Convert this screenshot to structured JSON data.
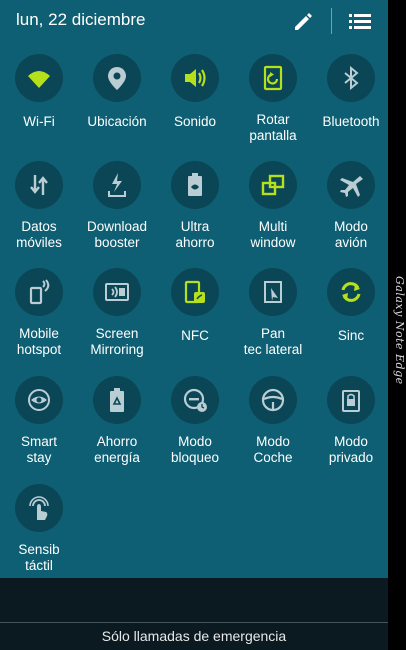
{
  "header": {
    "date": "lun, 22 diciembre"
  },
  "edge": {
    "label": "Galaxy Note Edge"
  },
  "footer": {
    "emergency": "Sólo llamadas de emergencia"
  },
  "colors": {
    "active": "#b6e01c",
    "inactive": "#b9cdd3",
    "panel": "#0e5f73",
    "circle": "#0a4656"
  },
  "tiles": [
    {
      "label": "Wi-Fi",
      "icon": "wifi-icon",
      "active": true
    },
    {
      "label": "Ubicación",
      "icon": "location-pin-icon",
      "active": false
    },
    {
      "label": "Sonido",
      "icon": "speaker-icon",
      "active": true
    },
    {
      "label": "Rotar pantalla",
      "icon": "rotate-screen-icon",
      "active": true
    },
    {
      "label": "Bluetooth",
      "icon": "bluetooth-icon",
      "active": false
    },
    {
      "label": "Datos móviles",
      "icon": "mobile-data-icon",
      "active": false
    },
    {
      "label": "Download booster",
      "icon": "download-booster-icon",
      "active": false
    },
    {
      "label": "Ultra ahorro",
      "icon": "ultra-power-saving-icon",
      "active": false
    },
    {
      "label": "Multi window",
      "icon": "multi-window-icon",
      "active": true
    },
    {
      "label": "Modo avión",
      "icon": "airplane-icon",
      "active": false
    },
    {
      "label": "Mobile hotspot",
      "icon": "hotspot-icon",
      "active": false
    },
    {
      "label": "Screen Mirroring",
      "icon": "screen-mirroring-icon",
      "active": false
    },
    {
      "label": "NFC",
      "icon": "nfc-icon",
      "active": true
    },
    {
      "label": "Pan tec lateral",
      "icon": "side-keypad-icon",
      "active": false
    },
    {
      "label": "Sinc",
      "icon": "sync-icon",
      "active": true
    },
    {
      "label": "Smart stay",
      "icon": "smart-stay-icon",
      "active": false
    },
    {
      "label": "Ahorro energía",
      "icon": "power-saving-icon",
      "active": false
    },
    {
      "label": "Modo bloqueo",
      "icon": "blocking-mode-icon",
      "active": false
    },
    {
      "label": "Modo Coche",
      "icon": "car-mode-icon",
      "active": false
    },
    {
      "label": "Modo privado",
      "icon": "private-mode-icon",
      "active": false
    },
    {
      "label": "Sensib táctil",
      "icon": "touch-sensitivity-icon",
      "active": false
    }
  ]
}
